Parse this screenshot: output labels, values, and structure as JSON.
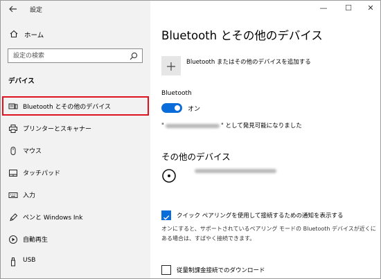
{
  "window": {
    "title": "設定",
    "controls": {
      "minimize": "—",
      "maximize": "☐",
      "close": "✕"
    }
  },
  "sidebar": {
    "back_icon": "back-arrow-icon",
    "home": {
      "label": "ホーム",
      "icon": "home-icon"
    },
    "search": {
      "placeholder": "設定の検索",
      "icon": "search-icon"
    },
    "section_heading": "デバイス",
    "items": [
      {
        "label": "Bluetooth とその他のデバイス",
        "icon": "bluetooth-devices-icon",
        "selected": true
      },
      {
        "label": "プリンターとスキャナー",
        "icon": "printer-icon"
      },
      {
        "label": "マウス",
        "icon": "mouse-icon"
      },
      {
        "label": "タッチパッド",
        "icon": "touchpad-icon"
      },
      {
        "label": "入力",
        "icon": "keyboard-icon"
      },
      {
        "label": "ペンと Windows Ink",
        "icon": "pen-icon"
      },
      {
        "label": "自動再生",
        "icon": "autoplay-icon"
      },
      {
        "label": "USB",
        "icon": "usb-icon"
      }
    ]
  },
  "main": {
    "title": "Bluetooth とその他のデバイス",
    "add_device": {
      "label": "Bluetooth またはその他のデバイスを追加する",
      "icon": "plus-icon"
    },
    "bluetooth": {
      "heading": "Bluetooth",
      "toggle_on": true,
      "toggle_state": "オン",
      "discoverable_open_quote": "\"",
      "discoverable_text": "\" として発見可能になりました"
    },
    "other_devices": {
      "heading": "その他のデバイス",
      "device_icon": "disc-device-icon"
    },
    "swift_pair": {
      "checked": true,
      "label": "クイック ペアリングを使用して接続するための通知を表示する",
      "description": "オンにすると、サポートされているペアリング モードの Bluetooth デバイスが近くにある場合は、すばやく接続できます。"
    },
    "metered": {
      "checked": false,
      "label": "従量制課金接続でのダウンロード"
    },
    "colors": {
      "accent": "#0a6cd8",
      "selection_outline": "#e0111e",
      "sidebar_bg": "#f2f2f2"
    }
  }
}
